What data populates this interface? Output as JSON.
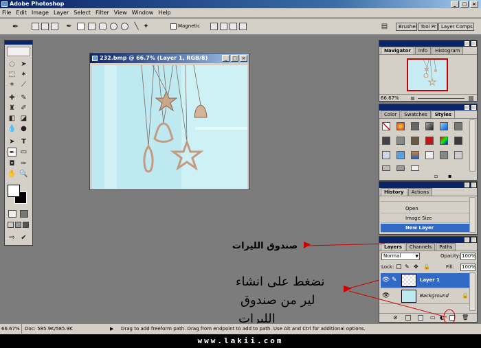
{
  "app": {
    "title": "Adobe Photoshop"
  },
  "menu": [
    "File",
    "Edit",
    "Image",
    "Layer",
    "Select",
    "Filter",
    "View",
    "Window",
    "Help"
  ],
  "options_bar": {
    "magnetic_label": "Magnetic",
    "wells": [
      "Brushes",
      "Tool Pr",
      "Layer Comps"
    ]
  },
  "document": {
    "title": "232.bmp @ 66.7% (Layer 1, RGB/8)"
  },
  "navigator": {
    "tabs": [
      "Navigator",
      "Info",
      "Histogram"
    ],
    "zoom": "66.67%"
  },
  "color_panel": {
    "tabs": [
      "Color",
      "Swatches",
      "Styles"
    ]
  },
  "history": {
    "tabs": [
      "History",
      "Actions"
    ],
    "items": [
      "Open",
      "Image Size",
      "New Layer"
    ],
    "active_item": "New Layer"
  },
  "layers": {
    "tabs": [
      "Layers",
      "Channels",
      "Paths"
    ],
    "blend_mode": "Normal",
    "opacity_label": "Opacity:",
    "opacity": "100%",
    "lock_label": "Lock:",
    "fill_label": "Fill:",
    "fill": "100%",
    "rows": [
      "Layer 1",
      "Background"
    ]
  },
  "status": {
    "zoom": "66.67%",
    "doc": "Doc: 585.9K/585.9K",
    "hint": "Drag to add freeform path.  Drag from endpoint to add to path.  Use Alt and Ctrl for additional options."
  },
  "annotations": {
    "top": "صندوق الليرات",
    "line1": "نضغط على انشاء",
    "line2": "لير من صندوق",
    "line3": "الليرات"
  },
  "footer": {
    "url": "www.lakii.com"
  },
  "colors": {
    "accent": "#0a246a",
    "arrow": "#cc0000",
    "selection": "#316ac5"
  }
}
